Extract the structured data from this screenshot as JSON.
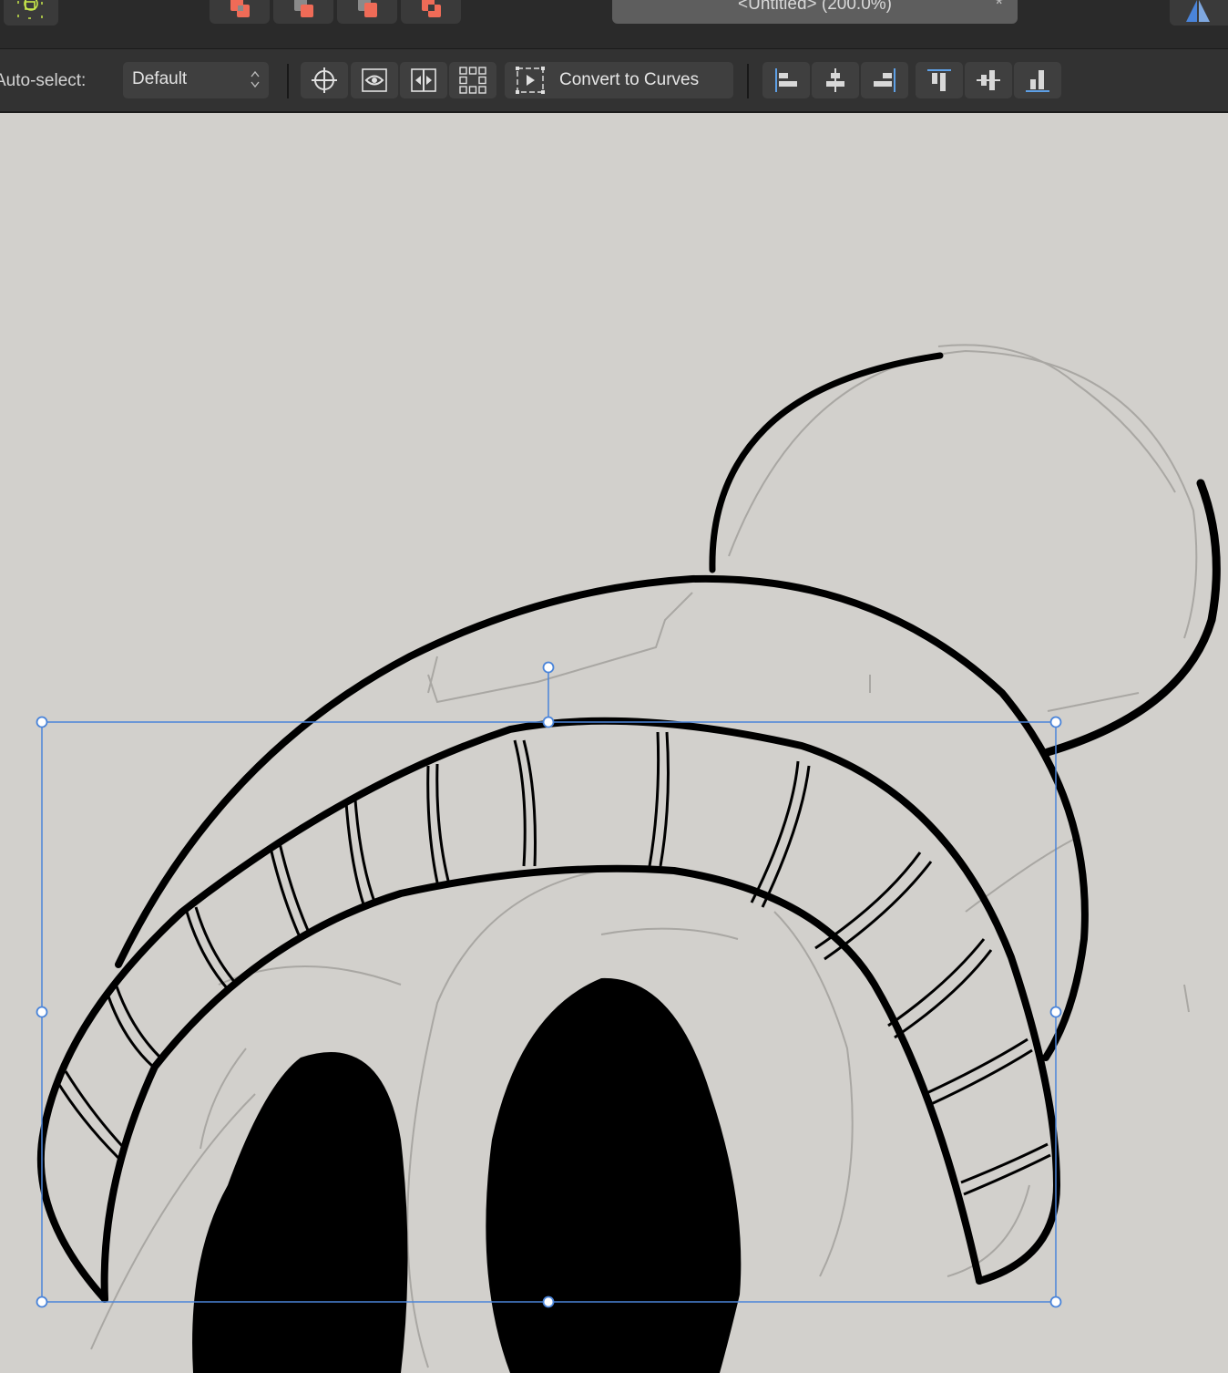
{
  "document": {
    "title": "<Untitled> (200.0%)",
    "close_glyph": "*"
  },
  "toolbar": {
    "auto_select_label": "Auto-select:",
    "auto_select_value": "Default",
    "convert_to_curves_label": "Convert to Curves"
  },
  "icons": {
    "persona": "designer-persona-icon",
    "boolean_ops": [
      "add-boolean-icon",
      "subtract-boolean-icon",
      "intersect-boolean-icon",
      "xor-boolean-icon"
    ],
    "transform_tools": [
      "transform-origin-icon",
      "show-selection-box-icon",
      "flip-horizontal-icon",
      "alignment-handles-icon"
    ],
    "convert_to_curves": "convert-to-curves-icon",
    "align": [
      "align-left-icon",
      "align-center-icon",
      "align-right-icon",
      "align-top-icon",
      "align-middle-icon",
      "align-bottom-icon"
    ]
  },
  "colors": {
    "accent_boolean": "#ef6b57",
    "selection": "#4a84d9",
    "align_accent": "#5ea0e6",
    "persona_green": "#c8e84a"
  }
}
